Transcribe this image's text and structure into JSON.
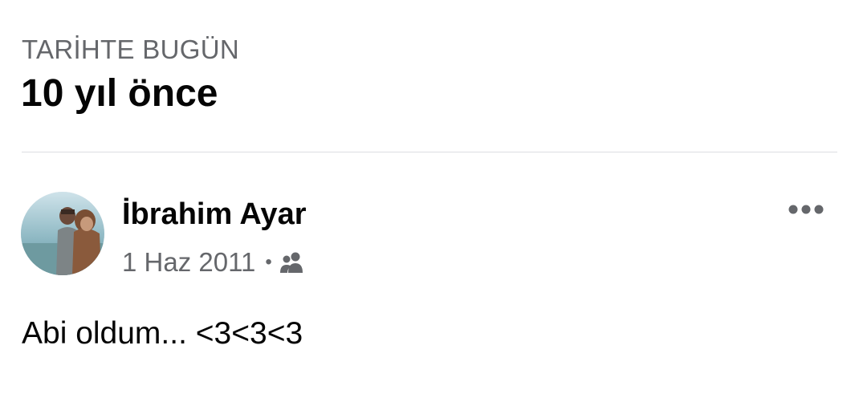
{
  "memories": {
    "section_label": "TARİHTE BUGÜN",
    "title": "10 yıl önce"
  },
  "post": {
    "author": "İbrahim Ayar",
    "date": "1 Haz 2011",
    "separator": "•",
    "audience_icon": "friends-icon",
    "text": "Abi oldum... <3<3<3",
    "more_icon": "more-options-icon"
  },
  "colors": {
    "primary_text": "#050505",
    "secondary_text": "#65676b",
    "divider": "#dcdde1",
    "background": "#ffffff"
  }
}
